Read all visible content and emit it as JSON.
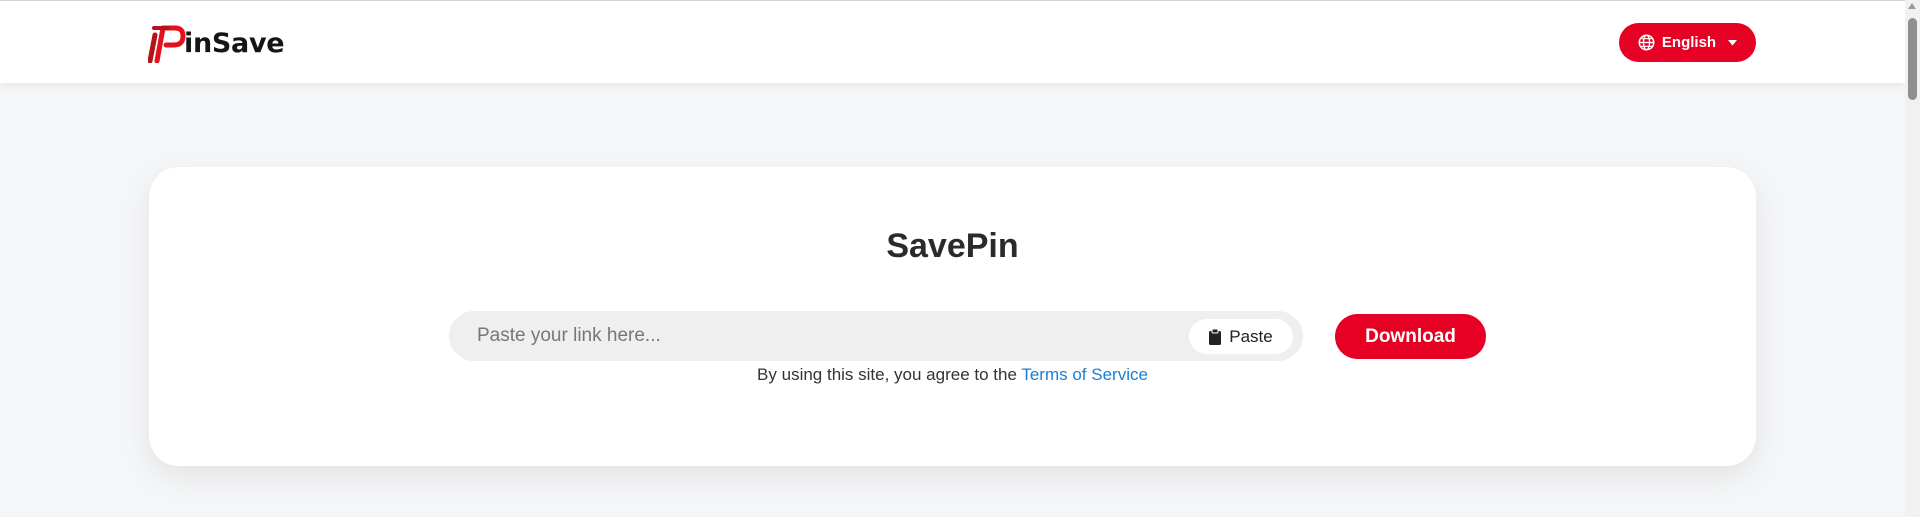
{
  "header": {
    "logo_text": "inSave",
    "logo_alt": "PinSave",
    "language_label": "English"
  },
  "main": {
    "title": "SavePin",
    "search": {
      "placeholder": "Paste your link here...",
      "value": ""
    },
    "paste_label": "Paste",
    "download_label": "Download",
    "terms_prefix": "By using this site, you agree to the ",
    "terms_link": "Terms of Service"
  },
  "colors": {
    "brand": "#e60023",
    "link": "#1a7fd4",
    "background": "#f5f6f7",
    "card": "#ffffff"
  },
  "icons": {
    "logo": "pinsave-logo-icon",
    "language": "globe-icon",
    "dropdown": "caret-down-icon",
    "paste": "clipboard-icon"
  }
}
